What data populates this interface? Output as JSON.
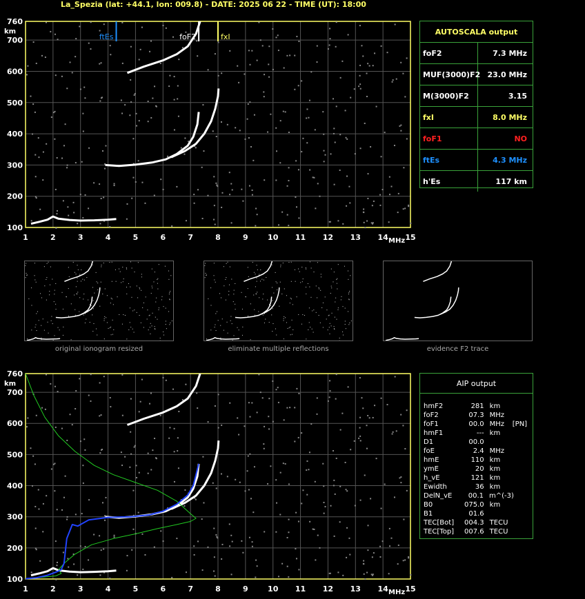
{
  "header": "La_Spezia (lat: +44.1, lon: 009.8) - DATE: 2025 06 22 - TIME (UT): 18:00",
  "colors": {
    "grid": "#555555",
    "axis": "#ffff66",
    "trace": "#ffffff",
    "green": "#22cc22",
    "blue": "#2244ff",
    "fEs": "#1e90ff",
    "fxI": "#ffff66"
  },
  "chart_data": [
    {
      "type": "scatter",
      "title": "",
      "xlabel": "MHz",
      "ylabel": "km",
      "xlim": [
        1,
        15
      ],
      "ylim": [
        100,
        760
      ],
      "x_ticks": [
        "1",
        "2",
        "3",
        "4",
        "5",
        "6",
        "7",
        "8",
        "9",
        "10",
        "11",
        "12",
        "13",
        "14",
        "15"
      ],
      "y_ticks": [
        "100",
        "200",
        "300",
        "400",
        "500",
        "600",
        "700",
        "760"
      ],
      "markers": [
        {
          "label": "ftEs",
          "x": 4.3,
          "color": "#1e90ff"
        },
        {
          "label": "foF2",
          "x": 7.3,
          "color": "#ffffff"
        },
        {
          "label": "fxI",
          "x": 8.0,
          "color": "#ffff66"
        }
      ],
      "series": [
        {
          "values": [
            [
              1.2,
              112
            ],
            [
              1.5,
              118
            ],
            [
              1.8,
              125
            ],
            [
              2.0,
              135
            ],
            [
              2.2,
              128
            ],
            [
              2.6,
              124
            ],
            [
              3.0,
              122
            ],
            [
              3.5,
              123
            ],
            [
              4.0,
              125
            ],
            [
              4.3,
              127
            ]
          ]
        },
        {
          "values": [
            [
              3.9,
              300
            ],
            [
              4.4,
              297
            ],
            [
              5.0,
              301
            ],
            [
              5.6,
              308
            ],
            [
              6.1,
              318
            ],
            [
              6.5,
              335
            ],
            [
              6.9,
              362
            ],
            [
              7.1,
              390
            ],
            [
              7.25,
              430
            ],
            [
              7.3,
              470
            ]
          ]
        },
        {
          "values": [
            [
              6.3,
              325
            ],
            [
              6.8,
              345
            ],
            [
              7.2,
              368
            ],
            [
              7.5,
              400
            ],
            [
              7.75,
              440
            ],
            [
              7.9,
              480
            ],
            [
              8.0,
              520
            ],
            [
              8.02,
              545
            ]
          ]
        },
        {
          "values": [
            [
              4.7,
              595
            ],
            [
              5.3,
              615
            ],
            [
              6.0,
              635
            ],
            [
              6.5,
              655
            ],
            [
              6.9,
              680
            ],
            [
              7.2,
              720
            ],
            [
              7.35,
              760
            ]
          ]
        }
      ]
    },
    {
      "type": "scatter",
      "title": "",
      "xlabel": "MHz",
      "ylabel": "km",
      "xlim": [
        1,
        15
      ],
      "ylim": [
        100,
        760
      ],
      "x_ticks": [
        "1",
        "2",
        "3",
        "4",
        "5",
        "6",
        "7",
        "8",
        "9",
        "10",
        "11",
        "12",
        "13",
        "14",
        "15"
      ],
      "y_ticks": [
        "100",
        "200",
        "300",
        "400",
        "500",
        "600",
        "700",
        "760"
      ],
      "series": [
        {
          "values": [
            [
              1.2,
              112
            ],
            [
              1.5,
              118
            ],
            [
              1.8,
              125
            ],
            [
              2.0,
              135
            ],
            [
              2.2,
              128
            ],
            [
              2.6,
              124
            ],
            [
              3.0,
              122
            ],
            [
              3.5,
              123
            ],
            [
              4.0,
              125
            ],
            [
              4.3,
              127
            ]
          ]
        },
        {
          "values": [
            [
              3.9,
              300
            ],
            [
              4.4,
              297
            ],
            [
              5.0,
              301
            ],
            [
              5.6,
              308
            ],
            [
              6.1,
              318
            ],
            [
              6.5,
              335
            ],
            [
              6.9,
              362
            ],
            [
              7.1,
              390
            ],
            [
              7.25,
              430
            ],
            [
              7.3,
              470
            ]
          ]
        },
        {
          "values": [
            [
              6.3,
              325
            ],
            [
              6.8,
              345
            ],
            [
              7.2,
              368
            ],
            [
              7.5,
              400
            ],
            [
              7.75,
              440
            ],
            [
              7.9,
              480
            ],
            [
              8.0,
              520
            ],
            [
              8.02,
              545
            ]
          ]
        },
        {
          "values": [
            [
              4.7,
              595
            ],
            [
              5.3,
              615
            ],
            [
              6.0,
              635
            ],
            [
              6.5,
              655
            ],
            [
              6.9,
              680
            ],
            [
              7.2,
              720
            ],
            [
              7.35,
              760
            ]
          ]
        },
        {
          "values": [
            [
              1.0,
              760
            ],
            [
              1.3,
              690
            ],
            [
              1.7,
              620
            ],
            [
              2.2,
              560
            ],
            [
              2.8,
              510
            ],
            [
              3.5,
              465
            ],
            [
              4.2,
              435
            ],
            [
              5.0,
              410
            ],
            [
              5.8,
              385
            ],
            [
              6.5,
              350
            ],
            [
              7.0,
              310
            ],
            [
              7.2,
              295
            ],
            [
              7.0,
              285
            ],
            [
              6.5,
              275
            ],
            [
              5.8,
              262
            ],
            [
              5.0,
              245
            ],
            [
              4.2,
              230
            ],
            [
              3.4,
              210
            ],
            [
              2.8,
              180
            ],
            [
              2.4,
              150
            ],
            [
              2.2,
              130
            ],
            [
              2.3,
              118
            ],
            [
              2.1,
              110
            ],
            [
              1.5,
              105
            ],
            [
              1.0,
              100
            ]
          ]
        },
        {
          "values": [
            [
              1.0,
              101
            ],
            [
              1.4,
              104
            ],
            [
              1.8,
              112
            ],
            [
              2.1,
              122
            ],
            [
              2.3,
              130
            ],
            [
              2.4,
              150
            ],
            [
              2.5,
              230
            ],
            [
              2.7,
              275
            ],
            [
              2.9,
              270
            ],
            [
              3.3,
              290
            ],
            [
              4.0,
              298
            ],
            [
              4.8,
              300
            ],
            [
              5.5,
              306
            ],
            [
              6.0,
              318
            ],
            [
              6.5,
              340
            ],
            [
              6.9,
              370
            ],
            [
              7.1,
              400
            ],
            [
              7.3,
              470
            ]
          ]
        }
      ]
    }
  ],
  "autoscala": {
    "title": "AUTOSCALA output",
    "rows": [
      {
        "k": "foF2",
        "v": "7.3 MHz",
        "color": "#ffffff"
      },
      {
        "k": "MUF(3000)F2",
        "v": "23.0 MHz",
        "color": "#ffffff"
      },
      {
        "k": "M(3000)F2",
        "v": "3.15",
        "color": "#ffffff"
      },
      {
        "k": "fxI",
        "v": "8.0 MHz",
        "color": "#ffff66"
      },
      {
        "k": "foF1",
        "v": "NO",
        "color": "#ff2020"
      },
      {
        "k": "ftEs",
        "v": "4.3 MHz",
        "color": "#1e90ff"
      },
      {
        "k": "h'Es",
        "v": "117     km",
        "color": "#ffffff"
      }
    ]
  },
  "aip": {
    "title": "AIP output",
    "rows": [
      [
        "hmF2",
        "281",
        "km",
        ""
      ],
      [
        "foF2",
        "07.3",
        "MHz",
        ""
      ],
      [
        "foF1",
        "00.0",
        "MHz",
        "[PN]"
      ],
      [
        "hmF1",
        "---",
        "km",
        ""
      ],
      [
        "D1",
        "00.0",
        "",
        ""
      ],
      [
        "foE",
        "2.4",
        "MHz",
        ""
      ],
      [
        "hmE",
        "110",
        "km",
        ""
      ],
      [
        "ymE",
        "20",
        "km",
        ""
      ],
      [
        "h_vE",
        "121",
        "km",
        ""
      ],
      [
        "Ewidth",
        "36",
        "km",
        ""
      ],
      [
        "DelN_vE",
        "00.1",
        "m^(-3)",
        ""
      ],
      [
        "B0",
        "075.0",
        "km",
        ""
      ],
      [
        "B1",
        "01.6",
        "",
        ""
      ],
      [
        "TEC[Bot]",
        "004.3",
        "TECU",
        ""
      ],
      [
        "TEC[Top]",
        "007.6",
        "TECU",
        ""
      ]
    ]
  },
  "captions": {
    "original": "original ionogram resized",
    "multiple": "eliminate multiple reflections",
    "evidence": "evidence F2 trace"
  }
}
